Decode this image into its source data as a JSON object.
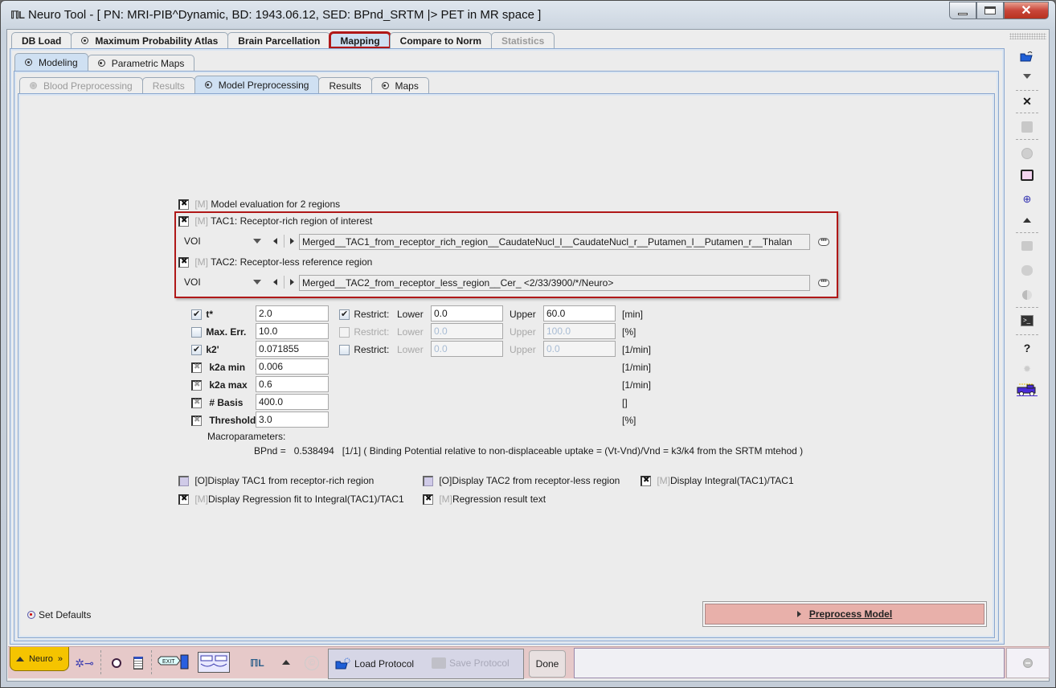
{
  "window": {
    "title": "Neuro Tool - [ PN: MRI-PIB^Dynamic, BD: 1943.06.12, SED: BPnd_SRTM |> PET in MR space ]",
    "app_icon": "pmod-pi-icon"
  },
  "main_tabs": [
    {
      "label": "DB Load",
      "state": "normal"
    },
    {
      "label": "Maximum Probability Atlas",
      "state": "normal",
      "dot": true
    },
    {
      "label": "Brain Parcellation",
      "state": "normal"
    },
    {
      "label": "Mapping",
      "state": "active-highlighted"
    },
    {
      "label": "Compare to Norm",
      "state": "normal"
    },
    {
      "label": "Statistics",
      "state": "disabled"
    }
  ],
  "sub_tabs": [
    {
      "label": "Modeling",
      "state": "active",
      "dot": true
    },
    {
      "label": "Parametric Maps",
      "state": "normal",
      "dot": true
    }
  ],
  "inner_tabs": [
    {
      "label": "Blood Preprocessing",
      "state": "disabled",
      "dot": true
    },
    {
      "label": "Results",
      "state": "disabled"
    },
    {
      "label": "Model Preprocessing",
      "state": "active",
      "dot": true
    },
    {
      "label": "Results",
      "state": "normal"
    },
    {
      "label": "Maps",
      "state": "normal",
      "dot": true
    }
  ],
  "model_eval": {
    "tag": "[M]",
    "label": "Model evaluation for 2 regions",
    "checked": true
  },
  "tac1": {
    "tag": "[M]",
    "label": "TAC1: Receptor-rich region of interest",
    "checked": true,
    "source": "VOI",
    "value": "Merged__TAC1_from_receptor_rich_region__CaudateNucl_l__CaudateNucl_r__Putamen_l__Putamen_r__Thalan"
  },
  "tac2": {
    "tag": "[M]",
    "label": "TAC2: Receptor-less reference region",
    "checked": true,
    "source": "VOI",
    "value": "Merged__TAC2_from_receptor_less_region__Cer_ <2/33/3900/*/Neuro>"
  },
  "params": [
    {
      "label": "t*",
      "value": "2.0",
      "checkbox": "checked",
      "restrict": {
        "shown": true,
        "checked": true,
        "enabled": true,
        "lower": "0.0",
        "upper": "60.0"
      },
      "unit": "[min]"
    },
    {
      "label": "Max. Err.",
      "value": "10.0",
      "checkbox": "unchecked",
      "restrict": {
        "shown": true,
        "checked": false,
        "enabled": false,
        "lower": "0.0",
        "upper": "100.0"
      },
      "unit": "[%]"
    },
    {
      "label": "k2'",
      "value": "0.071855",
      "checkbox": "checked",
      "restrict": {
        "shown": true,
        "checked": false,
        "enabled": true,
        "lower": "0.0",
        "upper": "0.0"
      },
      "unit": "[1/min]"
    },
    {
      "label": "k2a min",
      "value": "0.006",
      "checkbox": "fixed",
      "unit": "[1/min]"
    },
    {
      "label": "k2a max",
      "value": "0.6",
      "checkbox": "fixed",
      "unit": "[1/min]"
    },
    {
      "label": "# Basis",
      "value": "400.0",
      "checkbox": "fixed",
      "unit": "[]"
    },
    {
      "label": "Threshold",
      "value": "3.0",
      "checkbox": "fixed",
      "unit": "[%]"
    }
  ],
  "restrict_labels": {
    "restrict": "Restrict:",
    "lower": "Lower",
    "upper": "Upper"
  },
  "macro": {
    "heading": "Macroparameters:",
    "line": "BPnd =   0.538494   [1/1] ( Binding Potential relative to non-displaceable uptake = (Vt-Vnd)/Vnd = k3/k4 from the SRTM mtehod )"
  },
  "display_options": [
    {
      "tag": "[O]",
      "label": "Display TAC1 from receptor-rich region",
      "checked": false
    },
    {
      "tag": "[O]",
      "label": "Display TAC2 from receptor-less region",
      "checked": false
    },
    {
      "tag": "[M]",
      "label": "Display Integral(TAC1)/TAC1",
      "checked": true
    },
    {
      "tag": "[M]",
      "label": "Display Regression fit to Integral(TAC1)/TAC1",
      "checked": true
    },
    {
      "tag": "[M]",
      "label": "Regression result text",
      "checked": true
    }
  ],
  "set_defaults": "Set Defaults",
  "preprocess_button": "Preprocess Model",
  "bottom_bar": {
    "neuro_label": "Neuro",
    "load_protocol": "Load Protocol",
    "save_protocol": "Save Protocol",
    "done": "Done",
    "status": ""
  },
  "right_toolbar": [
    "open-folder-icon",
    "dropdown-arrow-icon",
    "close-all-icon",
    "save-icon",
    "circle-icon",
    "print-dialog-icon",
    "zoom-icon",
    "collapse-up-icon",
    "printer-icon",
    "brain-icon",
    "contrast-icon",
    "terminal-icon",
    "help-icon",
    "settings-icon",
    "truck-icon"
  ],
  "colors": {
    "highlight_red": "#b01818",
    "active_tab": "#cfe0f2",
    "bottom_bar": "#e6c9c9",
    "neuro_button": "#f5c400",
    "preprocess_button": "#e8b0aa"
  }
}
